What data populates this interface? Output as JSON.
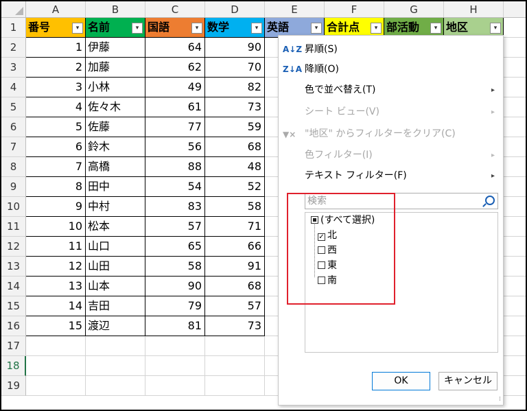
{
  "columns": [
    "A",
    "B",
    "C",
    "D",
    "E",
    "F",
    "G",
    "H"
  ],
  "rows": [
    "1",
    "2",
    "3",
    "4",
    "5",
    "6",
    "7",
    "8",
    "9",
    "10",
    "11",
    "12",
    "13",
    "14",
    "15",
    "16",
    "17",
    "18",
    "19"
  ],
  "headers": [
    "番号",
    "名前",
    "国語",
    "数学",
    "英語",
    "合計点",
    "部活動",
    "地区"
  ],
  "filter_arrow": "▾",
  "header_colors": [
    "#ffc000",
    "#00b050",
    "#ed7d31",
    "#00b0f0",
    "#8ea9db",
    "#ffff00",
    "#70ad47",
    "#a9d08e"
  ],
  "data_rows": [
    {
      "no": "1",
      "name": "伊藤",
      "kokugo": "64",
      "sugaku": "90"
    },
    {
      "no": "2",
      "name": "加藤",
      "kokugo": "62",
      "sugaku": "70"
    },
    {
      "no": "3",
      "name": "小林",
      "kokugo": "49",
      "sugaku": "82"
    },
    {
      "no": "4",
      "name": "佐々木",
      "kokugo": "61",
      "sugaku": "73"
    },
    {
      "no": "5",
      "name": "佐藤",
      "kokugo": "77",
      "sugaku": "59"
    },
    {
      "no": "6",
      "name": "鈴木",
      "kokugo": "56",
      "sugaku": "68"
    },
    {
      "no": "7",
      "name": "高橋",
      "kokugo": "88",
      "sugaku": "48"
    },
    {
      "no": "8",
      "name": "田中",
      "kokugo": "54",
      "sugaku": "52"
    },
    {
      "no": "9",
      "name": "中村",
      "kokugo": "83",
      "sugaku": "58"
    },
    {
      "no": "10",
      "name": "松本",
      "kokugo": "57",
      "sugaku": "71"
    },
    {
      "no": "11",
      "name": "山口",
      "kokugo": "65",
      "sugaku": "66"
    },
    {
      "no": "12",
      "name": "山田",
      "kokugo": "58",
      "sugaku": "91"
    },
    {
      "no": "13",
      "name": "山本",
      "kokugo": "90",
      "sugaku": "68"
    },
    {
      "no": "14",
      "name": "吉田",
      "kokugo": "79",
      "sugaku": "57"
    },
    {
      "no": "15",
      "name": "渡辺",
      "kokugo": "81",
      "sugaku": "73"
    }
  ],
  "active_row": "18",
  "menu": {
    "sort_asc": "昇順(S)",
    "sort_desc": "降順(O)",
    "sort_by_color": "色で並べ替え(T)",
    "sheet_view": "シート ビュー(V)",
    "clear_filter": "\"地区\" からフィルターをクリア(C)",
    "color_filter": "色フィルター(I)",
    "text_filter": "テキスト フィルター(F)",
    "icon_sort_asc": "A↓Z",
    "icon_sort_desc": "Z↓A",
    "icon_clear": "▼×",
    "submenu_arrow": "▸",
    "search_placeholder": "検索",
    "select_all": "(すべて選択)",
    "items": [
      {
        "label": "北",
        "checked": true
      },
      {
        "label": "西",
        "checked": false
      },
      {
        "label": "東",
        "checked": false
      },
      {
        "label": "南",
        "checked": false
      }
    ],
    "checkmark": "✓",
    "ok": "OK",
    "cancel": "キャンセル",
    "resize_grip": "⁞"
  },
  "highlight_color": "#e0202c"
}
